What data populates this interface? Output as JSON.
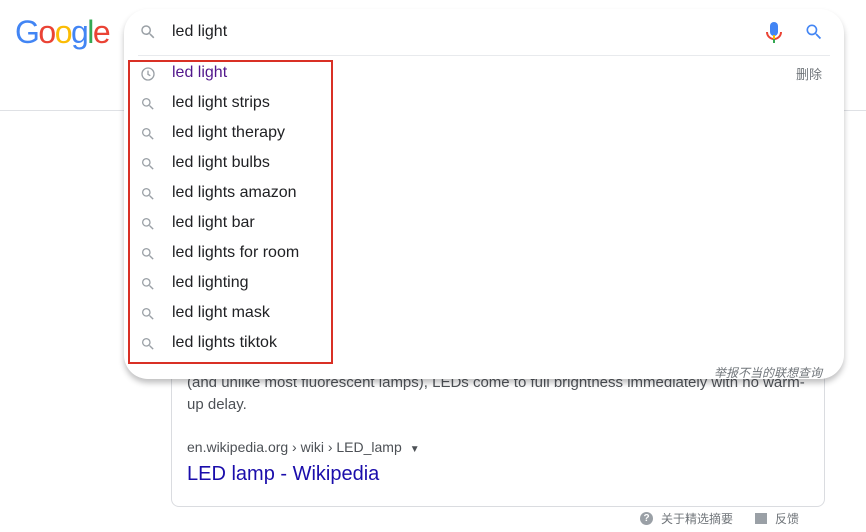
{
  "logo": {
    "letters": [
      "G",
      "o",
      "o",
      "g",
      "l",
      "e"
    ]
  },
  "search": {
    "query": "led light",
    "suggestions": [
      {
        "text": "led light",
        "type": "history"
      },
      {
        "text": "led light strips",
        "type": "search"
      },
      {
        "text": "led light therapy",
        "type": "search"
      },
      {
        "text": "led light bulbs",
        "type": "search"
      },
      {
        "text": "led lights amazon",
        "type": "search"
      },
      {
        "text": "led light bar",
        "type": "search"
      },
      {
        "text": "led lights for room",
        "type": "search"
      },
      {
        "text": "led lighting",
        "type": "search"
      },
      {
        "text": "led light mask",
        "type": "search"
      },
      {
        "text": "led lights tiktok",
        "type": "search"
      }
    ],
    "delete_label": "删除",
    "report_label": "举报不当的联想查询"
  },
  "result": {
    "snippet": "(and unlike most fluorescent lamps), LEDs come to full brightness immediately with no warm-up delay.",
    "cite": "en.wikipedia.org › wiki › LED_lamp",
    "title": "LED lamp - Wikipedia"
  },
  "footer": {
    "about_label": "关于精选摘要",
    "feedback_label": "反馈"
  },
  "colors": {
    "highlight_border": "#d93025",
    "link": "#1a0dab",
    "history_text": "#52188c"
  },
  "icons": {
    "search": "search-icon",
    "mic": "mic-icon",
    "history": "history-icon"
  }
}
